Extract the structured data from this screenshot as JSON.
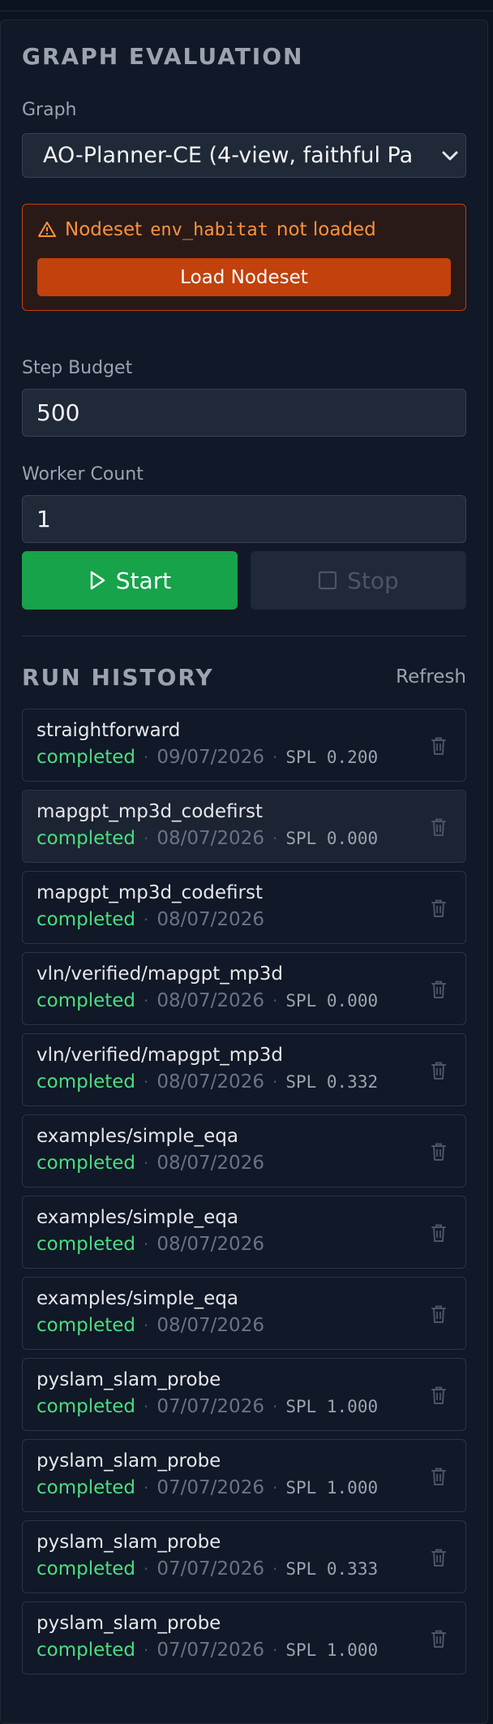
{
  "panel": {
    "title": "GRAPH EVALUATION",
    "graph_label": "Graph",
    "graph_value": "AO-Planner-CE (4-view, faithful Pa",
    "warning": {
      "prefix": "Nodeset",
      "code": "env_habitat",
      "suffix": "not loaded",
      "button": "Load Nodeset"
    },
    "step_budget_label": "Step Budget",
    "step_budget_value": "500",
    "worker_count_label": "Worker Count",
    "worker_count_value": "1",
    "start_label": "Start",
    "stop_label": "Stop"
  },
  "history": {
    "title": "RUN HISTORY",
    "refresh": "Refresh",
    "runs": [
      {
        "name": "straightforward",
        "status": "completed",
        "date": "09/07/2026",
        "spl": "SPL 0.200"
      },
      {
        "name": "mapgpt_mp3d_codefirst",
        "status": "completed",
        "date": "08/07/2026",
        "spl": "SPL 0.000"
      },
      {
        "name": "mapgpt_mp3d_codefirst",
        "status": "completed",
        "date": "08/07/2026",
        "spl": ""
      },
      {
        "name": "vln/verified/mapgpt_mp3d",
        "status": "completed",
        "date": "08/07/2026",
        "spl": "SPL 0.000"
      },
      {
        "name": "vln/verified/mapgpt_mp3d",
        "status": "completed",
        "date": "08/07/2026",
        "spl": "SPL 0.332"
      },
      {
        "name": "examples/simple_eqa",
        "status": "completed",
        "date": "08/07/2026",
        "spl": ""
      },
      {
        "name": "examples/simple_eqa",
        "status": "completed",
        "date": "08/07/2026",
        "spl": ""
      },
      {
        "name": "examples/simple_eqa",
        "status": "completed",
        "date": "08/07/2026",
        "spl": ""
      },
      {
        "name": "pyslam_slam_probe",
        "status": "completed",
        "date": "07/07/2026",
        "spl": "SPL 1.000"
      },
      {
        "name": "pyslam_slam_probe",
        "status": "completed",
        "date": "07/07/2026",
        "spl": "SPL 1.000"
      },
      {
        "name": "pyslam_slam_probe",
        "status": "completed",
        "date": "07/07/2026",
        "spl": "SPL 0.333"
      },
      {
        "name": "pyslam_slam_probe",
        "status": "completed",
        "date": "07/07/2026",
        "spl": "SPL 1.000"
      }
    ]
  },
  "colors": {
    "start": "#16a34a",
    "warning": "#c2410c",
    "status_completed": "#4ade80"
  },
  "icons": {
    "warning": "warning-triangle-icon",
    "select": "chevron-down-icon",
    "start": "play-icon",
    "stop": "stop-square-icon",
    "delete": "trash-icon"
  }
}
